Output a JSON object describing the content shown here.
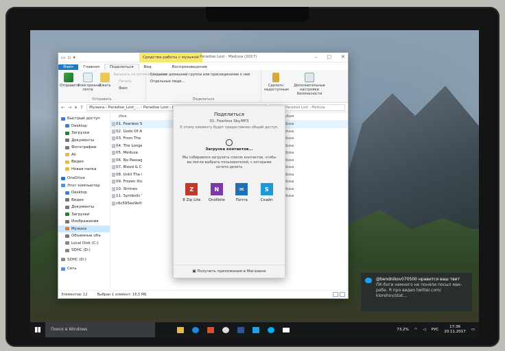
{
  "explorer": {
    "tools_context": "Средства работы с музыкой",
    "window_title": "Paradise Lost - Medusa (2017)",
    "tabs": [
      "Файл",
      "Главная",
      "Поделиться",
      "Вид",
      "Воспроизведение"
    ],
    "ribbon": {
      "send_label": "Отправить",
      "email_label": "Электронная почта",
      "zip_label": "Сжать",
      "send_group_label": "Отправить",
      "record_label": "Записать на оптический диск",
      "print_label": "Печать",
      "fax_label": "Факс",
      "homegroup_label": "Создание домашней группы или присоединение к ней",
      "specific_people_label": "Отдельные люди...",
      "share_group_label": "Поделиться",
      "stop_sharing_label": "Сделать недоступным",
      "advanced_security_label": "Дополнительные настройки безопасности"
    },
    "address": "Музыка › Paradise_Lost_... › Paradise Lost - Medusa (2017)",
    "search_placeholder": "Поиск: Paradise Lost - Medusa",
    "columns": {
      "name": "Имя",
      "album": "Альбом"
    },
    "nav_items": [
      {
        "label": "Быстрый доступ",
        "color": "#3b7dd8"
      },
      {
        "label": "Desktop",
        "color": "#3b7dd8"
      },
      {
        "label": "Загрузки",
        "color": "#2a7a3a"
      },
      {
        "label": "Документы",
        "color": "#777"
      },
      {
        "label": "Фотографии",
        "color": "#777"
      },
      {
        "label": "All",
        "color": "#e6b84a"
      },
      {
        "label": "Видео",
        "color": "#e6b84a"
      },
      {
        "label": "Новая папка",
        "color": "#e6b84a"
      },
      {
        "label": "OneDrive",
        "color": "#2a6fd6"
      },
      {
        "label": "Этот компьютер",
        "color": "#5b8dd6"
      },
      {
        "label": "Desktop",
        "color": "#3b7dd8"
      },
      {
        "label": "Видео",
        "color": "#777"
      },
      {
        "label": "Документы",
        "color": "#777"
      },
      {
        "label": "Загрузки",
        "color": "#2a7a3a"
      },
      {
        "label": "Изображения",
        "color": "#777"
      },
      {
        "label": "Музыка",
        "color": "#e07b39"
      },
      {
        "label": "Объемные объ",
        "color": "#777"
      },
      {
        "label": "Local Disk (C:)",
        "color": "#888"
      },
      {
        "label": "SDHC (D:)",
        "color": "#888"
      },
      {
        "label": "SDHC (D:)",
        "color": "#888"
      },
      {
        "label": "Сеть",
        "color": "#5b8dd6"
      }
    ],
    "files": [
      {
        "name": "01. Fearless Sky",
        "artist": "ost",
        "album": "Medusa"
      },
      {
        "name": "02. Gods Of An",
        "artist": "ost",
        "album": "Medusa"
      },
      {
        "name": "03. From The G",
        "artist": "ost",
        "album": "Medusa"
      },
      {
        "name": "04. The Longes",
        "artist": "ost",
        "album": "Medusa"
      },
      {
        "name": "05. Medusa",
        "artist": "ost",
        "album": "Medusa"
      },
      {
        "name": "06. No Passage",
        "artist": "ost",
        "album": "Medusa"
      },
      {
        "name": "07. Blood & Ch",
        "artist": "ost",
        "album": "Medusa"
      },
      {
        "name": "08. Until The G",
        "artist": "ost",
        "album": "Medusa"
      },
      {
        "name": "09. Frozen Illus",
        "artist": "ost",
        "album": "Medusa"
      },
      {
        "name": "10. Shrines",
        "artist": "ost",
        "album": "Medusa"
      },
      {
        "name": "11. Symbolic Vi",
        "artist": "ost",
        "album": "Medusa"
      },
      {
        "name": "c6c595ee9e09",
        "artist": "",
        "album": ""
      }
    ],
    "status_items": "Элементов: 12",
    "status_selected": "Выбран 1 элемент: 16,5 МБ"
  },
  "share_panel": {
    "title": "Поделиться",
    "file": "01. Fearless Sky.MP3",
    "note": "К этому элементу будет предоставлен общий доступ.",
    "loading": "Загрузка контактов...",
    "description": "Мы собираемся загрузить список контактов, чтобы вы могли выбрать пользователей, с которыми хотите делить",
    "apps": [
      {
        "label": "8 Zip Lite",
        "icon": "Z",
        "color": "#c0392b"
      },
      {
        "label": "OneNote",
        "icon": "N",
        "color": "#7b3aa6"
      },
      {
        "label": "Почта",
        "icon": "✉",
        "color": "#1f6fb5"
      },
      {
        "label": "Скайп",
        "icon": "S",
        "color": "#1a9ad6"
      }
    ],
    "store_link": "Получить приложения в Магазине"
  },
  "notification": {
    "title": "@bendnikov070500 нравится ваш твит",
    "body": "ПК-боги немного не поняли посыл мак-раба. Я про видео twitter.com/",
    "link": "klorehov/stat..."
  },
  "taskbar": {
    "search_placeholder": "Поиск в Windows",
    "battery": "73,2%",
    "language": "РУС",
    "time": "17:36",
    "date": "20.11.2017"
  }
}
